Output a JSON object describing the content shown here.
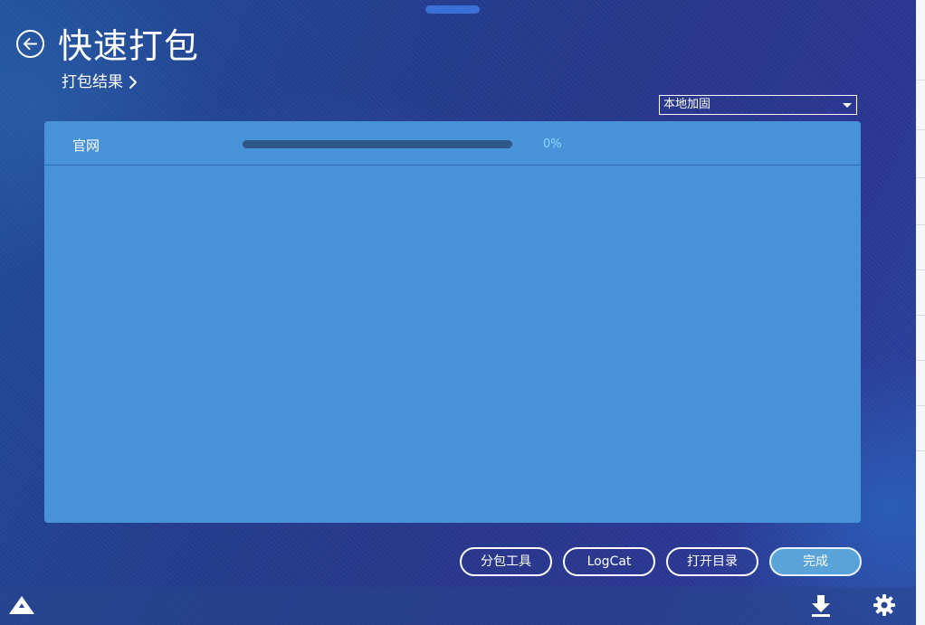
{
  "header": {
    "title": "快速打包",
    "breadcrumb": "打包结果",
    "back_icon": "arrow-left-circle-icon"
  },
  "channel_select": {
    "selected": "本地加固"
  },
  "panel": {
    "rows": [
      {
        "label": "官网",
        "progress": 0,
        "progress_text": "0%"
      }
    ]
  },
  "actions": {
    "split_tool": "分包工具",
    "logcat": "LogCat",
    "open_dir": "打开目录",
    "done": "完成"
  },
  "footer": {
    "logo_icon": "app-logo-icon",
    "download_icon": "download-icon",
    "settings_icon": "gear-icon"
  },
  "colors": {
    "panel_bg": "#4893d8",
    "progress_track": "#2e5887",
    "progress_text": "#8ed8ff",
    "primary_button": "#5aa3d8"
  }
}
